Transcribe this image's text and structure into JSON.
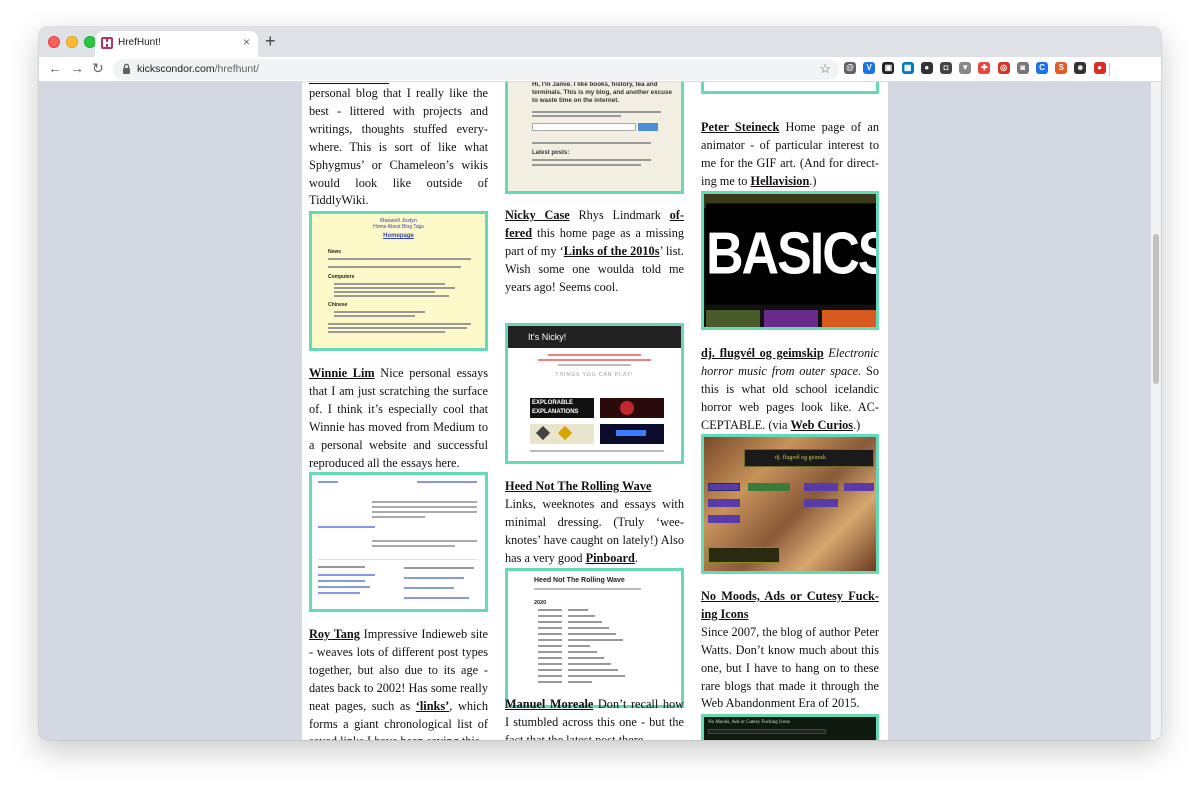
{
  "browser": {
    "tab_title": "HrefHunt!",
    "tab_close": "×",
    "new_tab": "+",
    "url_domain": "kickscondor.com",
    "url_path": "/hrefhunt/",
    "back": "←",
    "forward": "→",
    "reload": "↻",
    "star": "☆"
  },
  "extensions": [
    {
      "name": "shield-ext-icon",
      "color": "#5f6368",
      "glyph": "@"
    },
    {
      "name": "v-ext-icon",
      "color": "#1a73e8",
      "glyph": "V"
    },
    {
      "name": "box-ext-icon",
      "color": "#222222",
      "glyph": "▣"
    },
    {
      "name": "trello-ext-icon",
      "color": "#0079bf",
      "glyph": "▦"
    },
    {
      "name": "drop-ext-icon",
      "color": "#333333",
      "glyph": "●"
    },
    {
      "name": "square-ext-icon",
      "color": "#444444",
      "glyph": "◘"
    },
    {
      "name": "triangle-ext-icon",
      "color": "#888888",
      "glyph": "▼"
    },
    {
      "name": "puzzle-ext-icon",
      "color": "#e8453c",
      "glyph": "✚"
    },
    {
      "name": "stop-ext-icon",
      "color": "#d93025",
      "glyph": "◎"
    },
    {
      "name": "camera-ext-icon",
      "color": "#777777",
      "glyph": "◙"
    },
    {
      "name": "c-ext-icon",
      "color": "#1a73e8",
      "glyph": "C"
    },
    {
      "name": "s-ext-icon",
      "color": "#e25b2a",
      "glyph": "S"
    },
    {
      "name": "profile-ext-icon",
      "color": "#333333",
      "glyph": "☻"
    },
    {
      "name": "red-ext-icon",
      "color": "#d93025",
      "glyph": "●"
    }
  ],
  "col1": {
    "top_text": "personal blog that I really like the best - littered with projects and writings, thoughts stuffed every­where. This is sort of like what Sphygmus’ or Chameleon’s wikis would look like outside of TiddlyWiki.",
    "maxwell_thumb": {
      "name": "Maxwell Joslyn",
      "nav": "Home  About  Blog  Tags",
      "heading": "Homepage",
      "news": "News",
      "computers": "Computers",
      "chinese": "Chinese"
    },
    "winnie": {
      "name": "Winnie Lim",
      "text": " Nice personal essays that I am just scratching the surface of. I think it’s especially cool that Winnie has moved from Medium to a personal website and successful reproduced all the essays here."
    },
    "roy": {
      "name": "Roy Tang",
      "text1": " Impressive Indieweb site - weaves lots of different post types together, but also due to its age - dates back to 2002! Has some really neat pages, such as ",
      "link": "‘links’",
      "text2": ", which forms a giant chronological list of saved links I have been saving this"
    }
  },
  "col2": {
    "jamie_thumb": {
      "intro": "Hi, I'm Jamie. I like books, history, tea and terminals. This is my blog, and another excuse to waste time on the internet.",
      "latest": "Latest posts:"
    },
    "nicky": {
      "name": "Nicky Case",
      "text1": " Rhys Lindmark ",
      "link1": "of­fered",
      "text2": " this home page as a missing part of my ‘",
      "link2": "Links of the 2010s",
      "text3": "’ list. Wish some one woulda told me years ago! Seems cool."
    },
    "nicky_thumb": {
      "title": "It's Nicky!",
      "things": "THINGS YOU CAN PLAY!",
      "explorable": "EXPLORABLE EXPLANATIONS"
    },
    "heed": {
      "name": "Heed Not The Rolling Wave",
      "text1": "Links, weeknotes and essays with minimal dressing. (Truly ‘wee­knotes’ have caught on lately!) Also has a very good ",
      "link": "Pinboard",
      "text2": "."
    },
    "heed_thumb": {
      "title": "Heed Not The Rolling Wave",
      "year": "2020"
    },
    "manuel": {
      "name": "Manuel Moreale",
      "text": " Don’t recall how I stumbled across this one - but the fact that the latest post there"
    }
  },
  "col3": {
    "peter": {
      "name": "Peter Steineck",
      "text1": " Home page of an animator - of particular interest to me for the GIF art. (And for direct­ing me to ",
      "link": "Hellavision",
      "text2": ".)"
    },
    "basics_thumb": {
      "word": "BASICS"
    },
    "dj": {
      "name": "dj. flugvél og geimskip",
      "italic": " Electronic horror music from outer space.",
      "text1": " So this is what old school icelandic horror web pages look like. AC­CEPTABLE. (via ",
      "link": "Web Curios",
      "text2": ".)"
    },
    "dj_thumb": {
      "title": "dj. flugvél og geimsk"
    },
    "nomoods": {
      "name": "No Moods, Ads or Cutesy Fuck­ing Icons",
      "text": "Since 2007, the blog of author Peter Watts. Don’t know much about this one, but I have to hang on to these rare blogs that made it through the Web Abandonment Era of 2015."
    },
    "nomoods_thumb": {
      "title": "No Moods, Ads or Cutesy Fucking Icons"
    }
  },
  "colors": {
    "thumb_border": "#66d9b8",
    "page_bg": "#d3d8e2"
  }
}
